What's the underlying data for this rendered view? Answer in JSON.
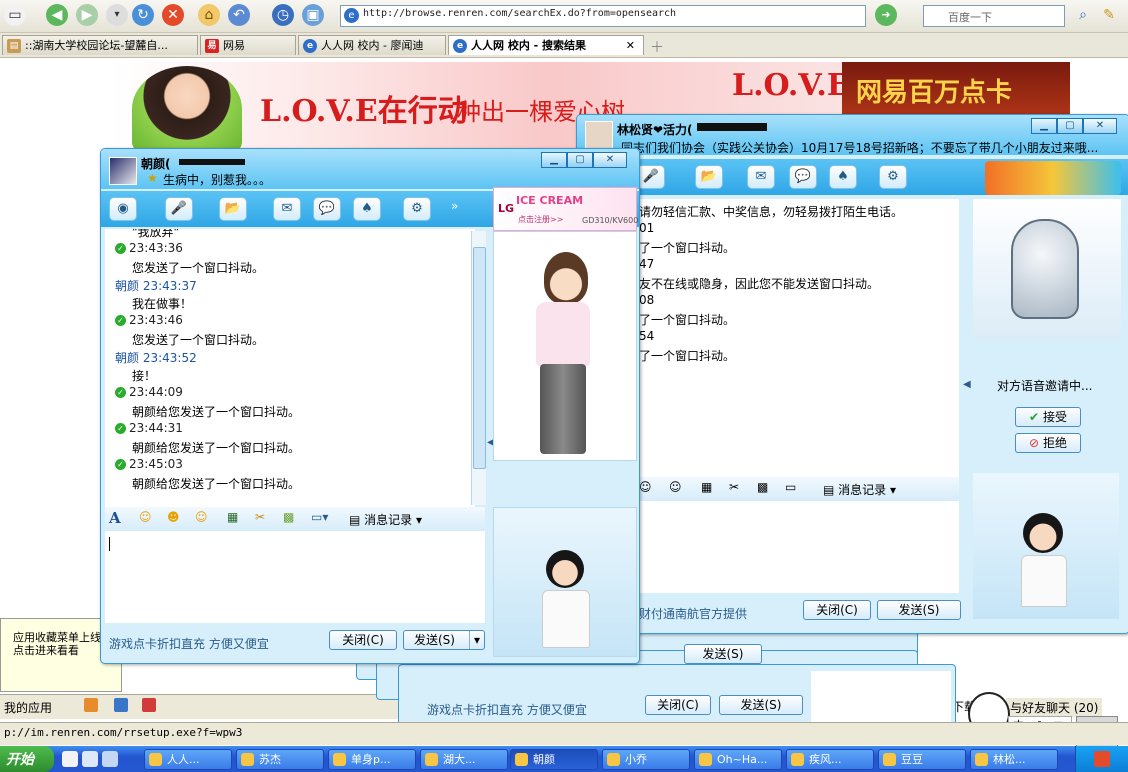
{
  "browser": {
    "url": "http://browse.renren.com/searchEx.do?from=opensearch",
    "search_placeholder": "百度一下",
    "search_engine_icon": "paw-icon",
    "status_url": "p://im.renren.com/rrsetup.exe?f=wpw3",
    "tabs": [
      {
        "label": "::湖南大学校园论坛-望麓自...",
        "icon": "forum-icon"
      },
      {
        "label": "网易",
        "icon": "netease-icon"
      },
      {
        "label": "人人网 校内 - 廖闻迪",
        "icon": "ie-icon"
      },
      {
        "label": "人人网 校内 - 搜索结果",
        "icon": "ie-icon",
        "active": true
      }
    ]
  },
  "page": {
    "banner_love": "L.O.V.E在行动",
    "banner_slogan": "种出一棵爱心树",
    "banner_love2": "L.O.V.E",
    "ad_right": "网易百万点卡",
    "tip_text": "应用收藏菜单上线\n点击进来看看",
    "fav_label": "我的应用",
    "right_chat_hint": "下载",
    "right_friend_chat": "与好友聊天 (20)"
  },
  "chat_front": {
    "contact": "朝颜(",
    "status_msg": "生病中，别惹我。。。",
    "ad_label": "ICE CREAM",
    "ad_brand": "LG",
    "ad_sub": "点击注册>>",
    "ad_model": "GD310/KV600",
    "messages": [
      {
        "type": "body",
        "text": "\"我放弃\""
      },
      {
        "type": "time",
        "text": "23:43:36"
      },
      {
        "type": "body",
        "text": "您发送了一个窗口抖动。"
      },
      {
        "type": "name",
        "text": "朝颜  23:43:37"
      },
      {
        "type": "body",
        "text": "我在做事！"
      },
      {
        "type": "time",
        "text": "23:43:46"
      },
      {
        "type": "body",
        "text": "您发送了一个窗口抖动。"
      },
      {
        "type": "name",
        "text": "朝颜  23:43:52"
      },
      {
        "type": "body",
        "text": "接！"
      },
      {
        "type": "time",
        "text": "23:44:09"
      },
      {
        "type": "body",
        "text": "朝颜给您发送了一个窗口抖动。"
      },
      {
        "type": "time",
        "text": "23:44:31"
      },
      {
        "type": "body",
        "text": "朝颜给您发送了一个窗口抖动。"
      },
      {
        "type": "time",
        "text": "23:45:03"
      },
      {
        "type": "body",
        "text": "朝颜给您发送了一个窗口抖动。"
      }
    ],
    "history_label": "消息记录",
    "footer_ad": "游戏点卡折扣直充 方便又便宜",
    "close_label": "关闭(C)",
    "send_label": "发送(S)"
  },
  "chat_back": {
    "contact": "林松贤❤活力(",
    "status_msg": "同志们我们协会（实践公关协会）10月17号18号招新咯；不要忘了带几个小朋友过来哦...",
    "messages": [
      {
        "text": "请勿轻信汇款、中奖信息，勿轻易拨打陌生电话。"
      },
      {
        "text": "01"
      },
      {
        "text": "了一个窗口抖动。"
      },
      {
        "text": "47"
      },
      {
        "text": "友不在线或隐身，因此您不能发送窗口抖动。"
      },
      {
        "text": "08"
      },
      {
        "text": "了一个窗口抖动。"
      },
      {
        "text": "54"
      },
      {
        "text": "了一个窗口抖动。"
      }
    ],
    "history_label": "消息记录",
    "footer_ad": "财付通南航官方提供",
    "voice_status": "对方语音邀请中...",
    "accept_label": "接受",
    "reject_label": "拒绝",
    "close_label": "关闭(C)",
    "send_label": "发送(S)"
  },
  "chat_bottom": {
    "footer_ad": "游戏点卡折扣直充 方便又便宜",
    "close_label": "关闭(C)",
    "send_label": "发送(S)",
    "send_label2": "发送(S)"
  },
  "taskbar": {
    "start_label": "开始",
    "tasks": [
      "人人...",
      "苏杰",
      "单身p...",
      "湖大...",
      "朝颜",
      "小乔",
      "Oh~Ha...",
      "疾风...",
      "豆豆",
      "林松..."
    ]
  },
  "colors": {
    "qq_blue": "#5cc4f3",
    "qq_border": "#3a9ad9",
    "taskbar_blue": "#2456cf"
  }
}
